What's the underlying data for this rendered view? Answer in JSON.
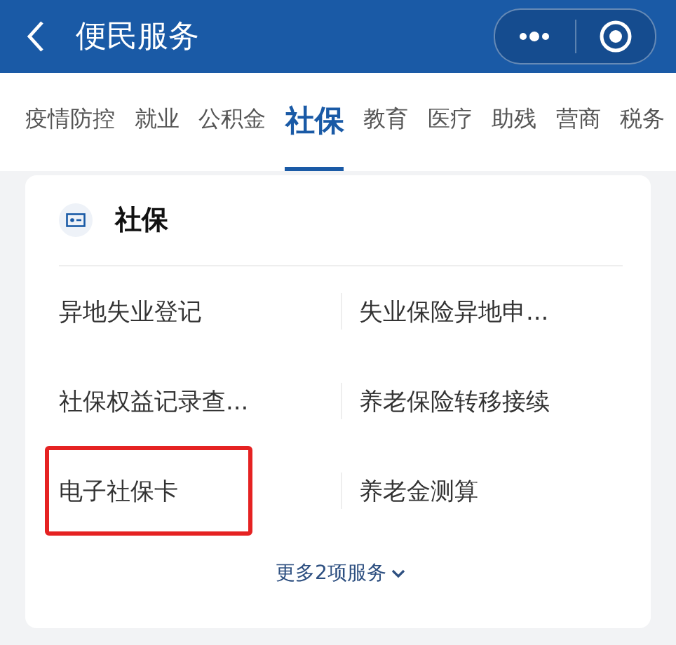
{
  "window": {
    "title": "便民服务"
  },
  "tabs": [
    {
      "label": "疫情防控",
      "selected": false
    },
    {
      "label": "就业",
      "selected": false
    },
    {
      "label": "公积金",
      "selected": false
    },
    {
      "label": "社保",
      "selected": true
    },
    {
      "label": "教育",
      "selected": false
    },
    {
      "label": "医疗",
      "selected": false
    },
    {
      "label": "助残",
      "selected": false
    },
    {
      "label": "营商",
      "selected": false
    },
    {
      "label": "税务",
      "selected": false
    }
  ],
  "card": {
    "title": "社保",
    "services": [
      {
        "label": "异地失业登记",
        "highlighted": false
      },
      {
        "label": "失业保险异地申...",
        "highlighted": false
      },
      {
        "label": "社保权益记录查...",
        "highlighted": false
      },
      {
        "label": "养老保险转移接续",
        "highlighted": false
      },
      {
        "label": "电子社保卡",
        "highlighted": true
      },
      {
        "label": "养老金测算",
        "highlighted": false
      }
    ],
    "more": "更多2项服务"
  }
}
